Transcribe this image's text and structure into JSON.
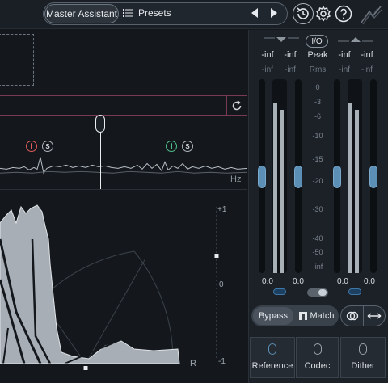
{
  "toolbar": {
    "assistant_label": "Master Assistant",
    "presets_label": "Presets",
    "icons": [
      "list-icon",
      "arrow-left-icon",
      "arrow-right-icon",
      "history-icon",
      "gear-icon",
      "help-icon",
      "logo-icon"
    ]
  },
  "spectrum": {
    "band1_badge": "S",
    "band2_badge": "S",
    "hz_label": "Hz"
  },
  "vectorscope": {
    "scale": [
      "+1",
      "0",
      "-1"
    ],
    "channel_label": "R"
  },
  "meters": {
    "io_label": "I/O",
    "in_peak": [
      "-inf",
      "-inf"
    ],
    "in_rms": [
      "-inf",
      "-inf"
    ],
    "out_peak": [
      "-inf",
      "-inf"
    ],
    "out_rms": [
      "-inf",
      "-inf"
    ],
    "peak_label": "Peak",
    "rms_label": "Rms",
    "db_scale": [
      "0",
      "-3",
      "-6",
      "-10",
      "-15",
      "-20",
      "-30",
      "-40",
      "-50",
      "-inf"
    ],
    "in_values": [
      "0.0",
      "0.0"
    ],
    "out_values": [
      "0.0",
      "0.0"
    ]
  },
  "controls": {
    "bypass_label": "Bypass",
    "match_label": "Match"
  },
  "bottom_buttons": {
    "reference": "Reference",
    "codec": "Codec",
    "dither": "Dither"
  },
  "colors": {
    "accent_blue": "#5c8fb6",
    "band_red": "#e05a5a",
    "band_green": "#4fc08a",
    "pink_border": "#7a3a56"
  }
}
